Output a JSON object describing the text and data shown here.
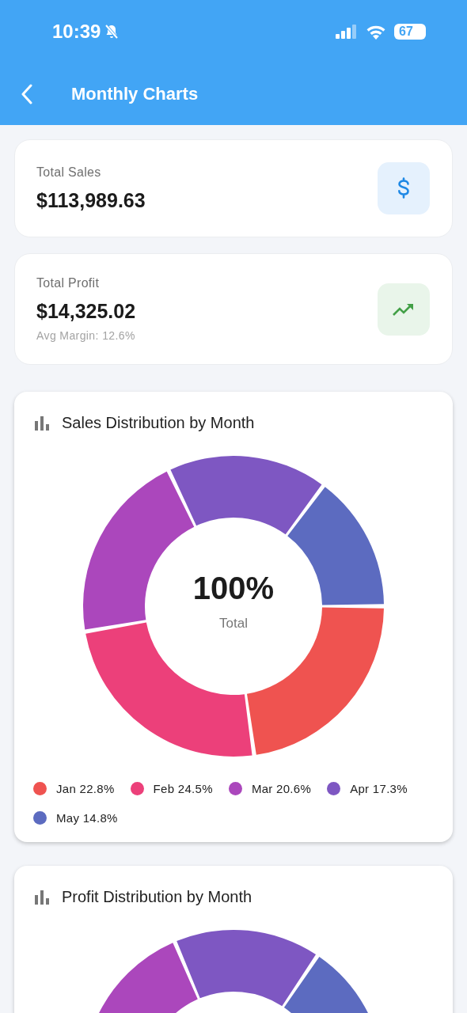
{
  "status_bar": {
    "time": "10:39",
    "battery": "67"
  },
  "app_bar": {
    "title": "Monthly Charts"
  },
  "stats": [
    {
      "kind": "sales",
      "label": "Total Sales",
      "value": "$113,989.63"
    },
    {
      "kind": "profit",
      "label": "Total Profit",
      "value": "$14,325.02",
      "note": "Avg Margin: 12.6%"
    }
  ],
  "sales_chart": {
    "title": "Sales Distribution by Month",
    "center_value": "100%",
    "center_label": "Total",
    "chart_data": {
      "type": "donut",
      "categories": [
        "Jan",
        "Feb",
        "Mar",
        "Apr",
        "May"
      ],
      "values": [
        22.8,
        24.5,
        20.6,
        17.3,
        14.8
      ]
    },
    "legend": [
      {
        "share": "22.8%",
        "color": "#ef5350"
      },
      {
        "share": "24.5%",
        "color": "#ec407a"
      },
      {
        "share": "20.6%",
        "color": "#ab47bc"
      },
      {
        "share": "17.3%",
        "color": "#7e57c2"
      },
      {
        "share": "14.8%",
        "color": "#5c6bc0"
      }
    ]
  },
  "profit_chart": {
    "title": "Profit Distribution by Month"
  }
}
